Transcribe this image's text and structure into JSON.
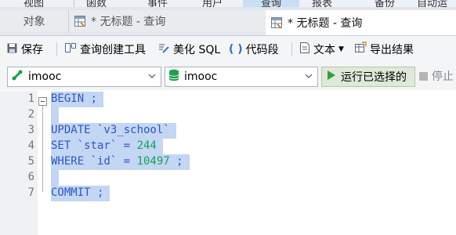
{
  "menu": {
    "items": [
      "视图",
      "函数",
      "事件",
      "用户",
      "查询",
      "报表",
      "备份",
      "自动运"
    ],
    "active_index": 4
  },
  "tabs": {
    "objects": "对象",
    "query1": "* 无标题 - 查询",
    "query2": "* 无标题 - 查询"
  },
  "toolbar": {
    "save": "保存",
    "query_builder": "查询创建工具",
    "beautify_sql": "美化 SQL",
    "code_snippet": "代码段",
    "text": "文本",
    "export": "导出结果"
  },
  "connection": {
    "value": "imooc"
  },
  "database": {
    "value": "imooc"
  },
  "run_selected": "运行已选择的",
  "stop": "停止",
  "editor": {
    "line_numbers": [
      "1",
      "2",
      "3",
      "4",
      "5",
      "6",
      "7"
    ],
    "lines": [
      [
        {
          "t": "BEGIN ;",
          "c": "kw"
        }
      ],
      [],
      [
        {
          "t": "UPDATE `v3_school`",
          "c": "kw"
        }
      ],
      [
        {
          "t": "SET `star` = ",
          "c": "kw"
        },
        {
          "t": "244",
          "c": "num"
        }
      ],
      [
        {
          "t": "WHERE `id` = ",
          "c": "kw"
        },
        {
          "t": "10497",
          "c": "num"
        },
        {
          "t": " ;",
          "c": "kw"
        }
      ],
      [],
      [
        {
          "t": "COMMIT ;",
          "c": "kw"
        }
      ]
    ]
  },
  "colors": {
    "keyword": "#2c57c8",
    "number": "#16a05a",
    "selection": "#c3d6f3",
    "run_icon": "#2fa12f",
    "db_icon": "#1e9e4a"
  }
}
